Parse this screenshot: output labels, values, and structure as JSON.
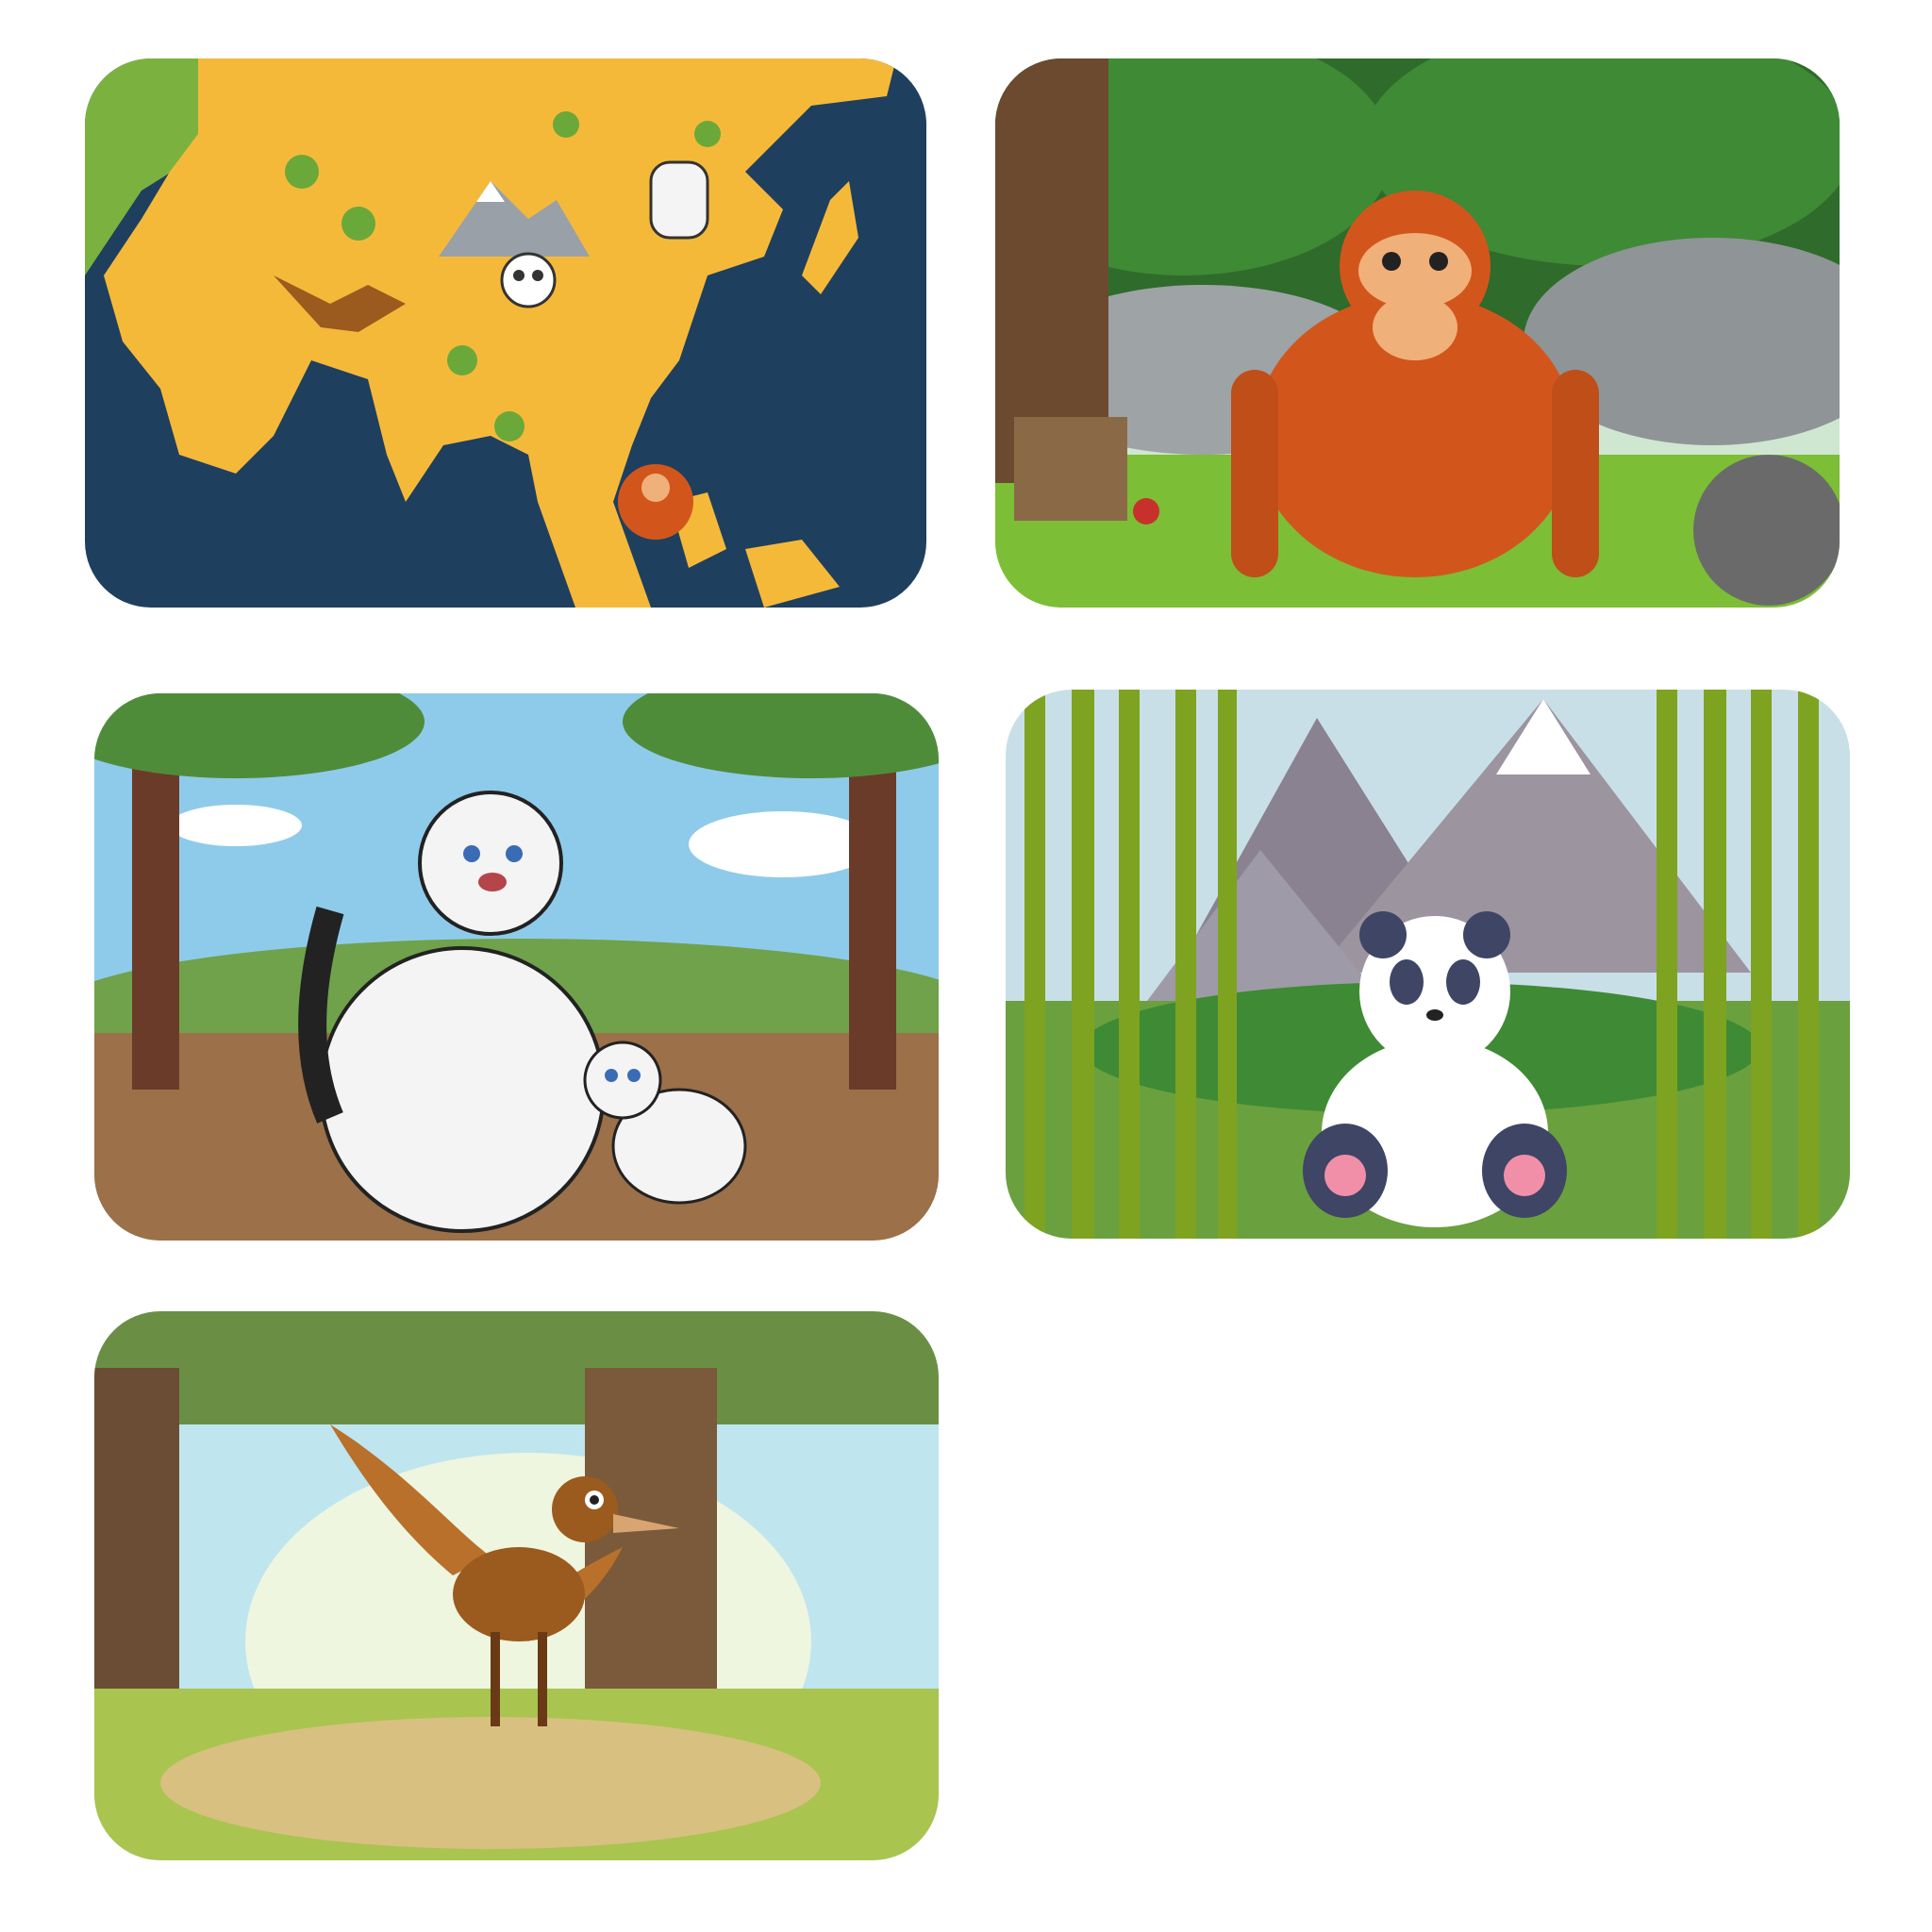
{
  "page": {
    "background": "#ffffff"
  },
  "cards": [
    {
      "id": "map",
      "subject": "asia-map-with-animals",
      "colors": {
        "ocean": "#1f3f5e",
        "land": "#f5b93a",
        "west": "#7bb23f"
      }
    },
    {
      "id": "orangutan",
      "subject": "orangutan-in-forest",
      "colors": {
        "fur": "#d2561c",
        "ground": "#7cbe35"
      }
    },
    {
      "id": "tiger",
      "subject": "white-tiger-and-cub",
      "colors": {
        "sky": "#8ecbea",
        "ground": "#9c7048"
      }
    },
    {
      "id": "panda",
      "subject": "panda-in-bamboo",
      "colors": {
        "bamboo": "#7ea321",
        "mountain": "#8a8290"
      }
    },
    {
      "id": "bird",
      "subject": "brown-bird-in-jungle",
      "colors": {
        "bird": "#9b5a1e",
        "glade": "#d8e48c"
      }
    }
  ]
}
